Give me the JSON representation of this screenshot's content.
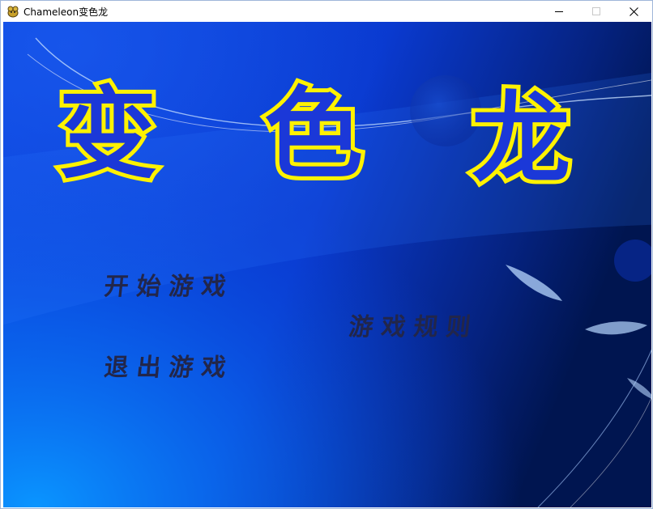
{
  "window": {
    "title": "Chameleon变色龙",
    "controls": {
      "minimize_icon": "minimize-icon",
      "maximize_icon": "maximize-icon",
      "close_icon": "close-icon"
    }
  },
  "game": {
    "logo": {
      "chars": [
        "变",
        "色",
        "龙"
      ],
      "outline_color": "#fff200",
      "fill_color": "#1b38d8"
    },
    "menu": {
      "start": "开始游戏",
      "rules": "游戏规则",
      "exit": "退出游戏",
      "text_color": "#22264a"
    },
    "background": {
      "top_color": "#0a3fd6",
      "right_color": "#001a5e",
      "bottom_left_color": "#0a8cff"
    }
  }
}
